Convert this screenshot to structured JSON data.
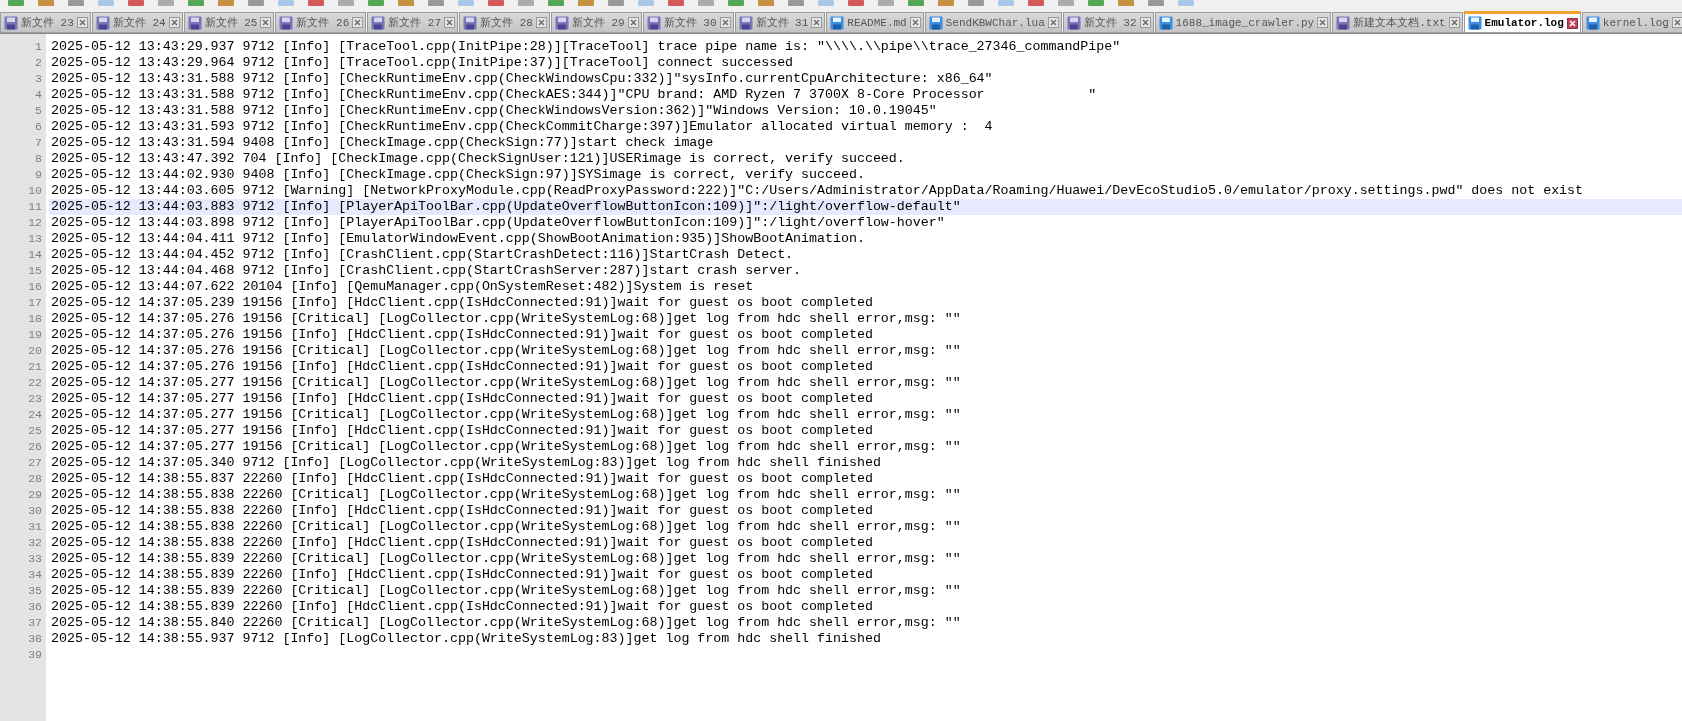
{
  "tabs": [
    {
      "label": "新文件 23",
      "saved": false,
      "selected": false
    },
    {
      "label": "新文件 24",
      "saved": false,
      "selected": false
    },
    {
      "label": "新文件 25",
      "saved": false,
      "selected": false
    },
    {
      "label": "新文件 26",
      "saved": false,
      "selected": false
    },
    {
      "label": "新文件 27",
      "saved": false,
      "selected": false
    },
    {
      "label": "新文件 28",
      "saved": false,
      "selected": false
    },
    {
      "label": "新文件 29",
      "saved": false,
      "selected": false
    },
    {
      "label": "新文件 30",
      "saved": false,
      "selected": false
    },
    {
      "label": "新文件 31",
      "saved": false,
      "selected": false
    },
    {
      "label": "README.md",
      "saved": true,
      "selected": false
    },
    {
      "label": "SendKBWChar.lua",
      "saved": true,
      "selected": false
    },
    {
      "label": "新文件 32",
      "saved": false,
      "selected": false
    },
    {
      "label": "1688_image_crawler.py",
      "saved": true,
      "selected": false
    },
    {
      "label": "新建文本文档.txt",
      "saved": false,
      "selected": false
    },
    {
      "label": "Emulator.log",
      "saved": true,
      "selected": true
    },
    {
      "label": "kernel.log",
      "saved": true,
      "selected": false
    }
  ],
  "lines": [
    {
      "number": "1",
      "text": "2025-05-12 13:43:29.937 9712 [Info] [TraceTool.cpp(InitPipe:28)][TraceTool] trace pipe name is: \"\\\\\\\\.\\\\pipe\\\\trace_27346_commandPipe\"",
      "current": false
    },
    {
      "number": "2",
      "text": "2025-05-12 13:43:29.964 9712 [Info] [TraceTool.cpp(InitPipe:37)][TraceTool] connect successed",
      "current": false
    },
    {
      "number": "3",
      "text": "2025-05-12 13:43:31.588 9712 [Info] [CheckRuntimeEnv.cpp(CheckWindowsCpu:332)]\"sysInfo.currentCpuArchitecture: x86_64\"",
      "current": false
    },
    {
      "number": "4",
      "text": "2025-05-12 13:43:31.588 9712 [Info] [CheckRuntimeEnv.cpp(CheckAES:344)]\"CPU brand: AMD Ryzen 7 3700X 8-Core Processor             \"",
      "current": false
    },
    {
      "number": "5",
      "text": "2025-05-12 13:43:31.588 9712 [Info] [CheckRuntimeEnv.cpp(CheckWindowsVersion:362)]\"Windows Version: 10.0.19045\"",
      "current": false
    },
    {
      "number": "6",
      "text": "2025-05-12 13:43:31.593 9712 [Info] [CheckRuntimeEnv.cpp(CheckCommitCharge:397)]Emulator allocated virtual memory :  4",
      "current": false
    },
    {
      "number": "7",
      "text": "2025-05-12 13:43:31.594 9408 [Info] [CheckImage.cpp(CheckSign:77)]start check image",
      "current": false
    },
    {
      "number": "8",
      "text": "2025-05-12 13:43:47.392 704 [Info] [CheckImage.cpp(CheckSignUser:121)]USERimage is correct, verify succeed.",
      "current": false
    },
    {
      "number": "9",
      "text": "2025-05-12 13:44:02.930 9408 [Info] [CheckImage.cpp(CheckSign:97)]SYSimage is correct, verify succeed.",
      "current": false
    },
    {
      "number": "10",
      "text": "2025-05-12 13:44:03.605 9712 [Warning] [NetworkProxyModule.cpp(ReadProxyPassword:222)]\"C:/Users/Administrator/AppData/Roaming/Huawei/DevEcoStudio5.0/emulator/proxy.settings.pwd\" does not exist",
      "current": false
    },
    {
      "number": "11",
      "text": "2025-05-12 13:44:03.883 9712 [Info] [PlayerApiToolBar.cpp(UpdateOverflowButtonIcon:109)]\":/light/overflow-default\"",
      "current": true
    },
    {
      "number": "12",
      "text": "2025-05-12 13:44:03.898 9712 [Info] [PlayerApiToolBar.cpp(UpdateOverflowButtonIcon:109)]\":/light/overflow-hover\"",
      "current": false
    },
    {
      "number": "13",
      "text": "2025-05-12 13:44:04.411 9712 [Info] [EmulatorWindowEvent.cpp(ShowBootAnimation:935)]ShowBootAnimation.",
      "current": false
    },
    {
      "number": "14",
      "text": "2025-05-12 13:44:04.452 9712 [Info] [CrashClient.cpp(StartCrashDetect:116)]StartCrash Detect.",
      "current": false
    },
    {
      "number": "15",
      "text": "2025-05-12 13:44:04.468 9712 [Info] [CrashClient.cpp(StartCrashServer:287)]start crash server.",
      "current": false
    },
    {
      "number": "16",
      "text": "2025-05-12 13:44:07.622 20104 [Info] [QemuManager.cpp(OnSystemReset:482)]System is reset",
      "current": false
    },
    {
      "number": "17",
      "text": "2025-05-12 14:37:05.239 19156 [Info] [HdcClient.cpp(IsHdcConnected:91)]wait for guest os boot completed",
      "current": false
    },
    {
      "number": "18",
      "text": "2025-05-12 14:37:05.276 19156 [Critical] [LogCollector.cpp(WriteSystemLog:68)]get log from hdc shell error,msg: \"\"",
      "current": false
    },
    {
      "number": "19",
      "text": "2025-05-12 14:37:05.276 19156 [Info] [HdcClient.cpp(IsHdcConnected:91)]wait for guest os boot completed",
      "current": false
    },
    {
      "number": "20",
      "text": "2025-05-12 14:37:05.276 19156 [Critical] [LogCollector.cpp(WriteSystemLog:68)]get log from hdc shell error,msg: \"\"",
      "current": false
    },
    {
      "number": "21",
      "text": "2025-05-12 14:37:05.276 19156 [Info] [HdcClient.cpp(IsHdcConnected:91)]wait for guest os boot completed",
      "current": false
    },
    {
      "number": "22",
      "text": "2025-05-12 14:37:05.277 19156 [Critical] [LogCollector.cpp(WriteSystemLog:68)]get log from hdc shell error,msg: \"\"",
      "current": false
    },
    {
      "number": "23",
      "text": "2025-05-12 14:37:05.277 19156 [Info] [HdcClient.cpp(IsHdcConnected:91)]wait for guest os boot completed",
      "current": false
    },
    {
      "number": "24",
      "text": "2025-05-12 14:37:05.277 19156 [Critical] [LogCollector.cpp(WriteSystemLog:68)]get log from hdc shell error,msg: \"\"",
      "current": false
    },
    {
      "number": "25",
      "text": "2025-05-12 14:37:05.277 19156 [Info] [HdcClient.cpp(IsHdcConnected:91)]wait for guest os boot completed",
      "current": false
    },
    {
      "number": "26",
      "text": "2025-05-12 14:37:05.277 19156 [Critical] [LogCollector.cpp(WriteSystemLog:68)]get log from hdc shell error,msg: \"\"",
      "current": false
    },
    {
      "number": "27",
      "text": "2025-05-12 14:37:05.340 9712 [Info] [LogCollector.cpp(WriteSystemLog:83)]get log from hdc shell finished",
      "current": false
    },
    {
      "number": "28",
      "text": "2025-05-12 14:38:55.837 22260 [Info] [HdcClient.cpp(IsHdcConnected:91)]wait for guest os boot completed",
      "current": false
    },
    {
      "number": "29",
      "text": "2025-05-12 14:38:55.838 22260 [Critical] [LogCollector.cpp(WriteSystemLog:68)]get log from hdc shell error,msg: \"\"",
      "current": false
    },
    {
      "number": "30",
      "text": "2025-05-12 14:38:55.838 22260 [Info] [HdcClient.cpp(IsHdcConnected:91)]wait for guest os boot completed",
      "current": false
    },
    {
      "number": "31",
      "text": "2025-05-12 14:38:55.838 22260 [Critical] [LogCollector.cpp(WriteSystemLog:68)]get log from hdc shell error,msg: \"\"",
      "current": false
    },
    {
      "number": "32",
      "text": "2025-05-12 14:38:55.838 22260 [Info] [HdcClient.cpp(IsHdcConnected:91)]wait for guest os boot completed",
      "current": false
    },
    {
      "number": "33",
      "text": "2025-05-12 14:38:55.839 22260 [Critical] [LogCollector.cpp(WriteSystemLog:68)]get log from hdc shell error,msg: \"\"",
      "current": false
    },
    {
      "number": "34",
      "text": "2025-05-12 14:38:55.839 22260 [Info] [HdcClient.cpp(IsHdcConnected:91)]wait for guest os boot completed",
      "current": false
    },
    {
      "number": "35",
      "text": "2025-05-12 14:38:55.839 22260 [Critical] [LogCollector.cpp(WriteSystemLog:68)]get log from hdc shell error,msg: \"\"",
      "current": false
    },
    {
      "number": "36",
      "text": "2025-05-12 14:38:55.839 22260 [Info] [HdcClient.cpp(IsHdcConnected:91)]wait for guest os boot completed",
      "current": false
    },
    {
      "number": "37",
      "text": "2025-05-12 14:38:55.840 22260 [Critical] [LogCollector.cpp(WriteSystemLog:68)]get log from hdc shell error,msg: \"\"",
      "current": false
    },
    {
      "number": "38",
      "text": "2025-05-12 14:38:55.937 9712 [Info] [LogCollector.cpp(WriteSystemLog:83)]get log from hdc shell finished",
      "current": false
    },
    {
      "number": "39",
      "current": false
    }
  ]
}
